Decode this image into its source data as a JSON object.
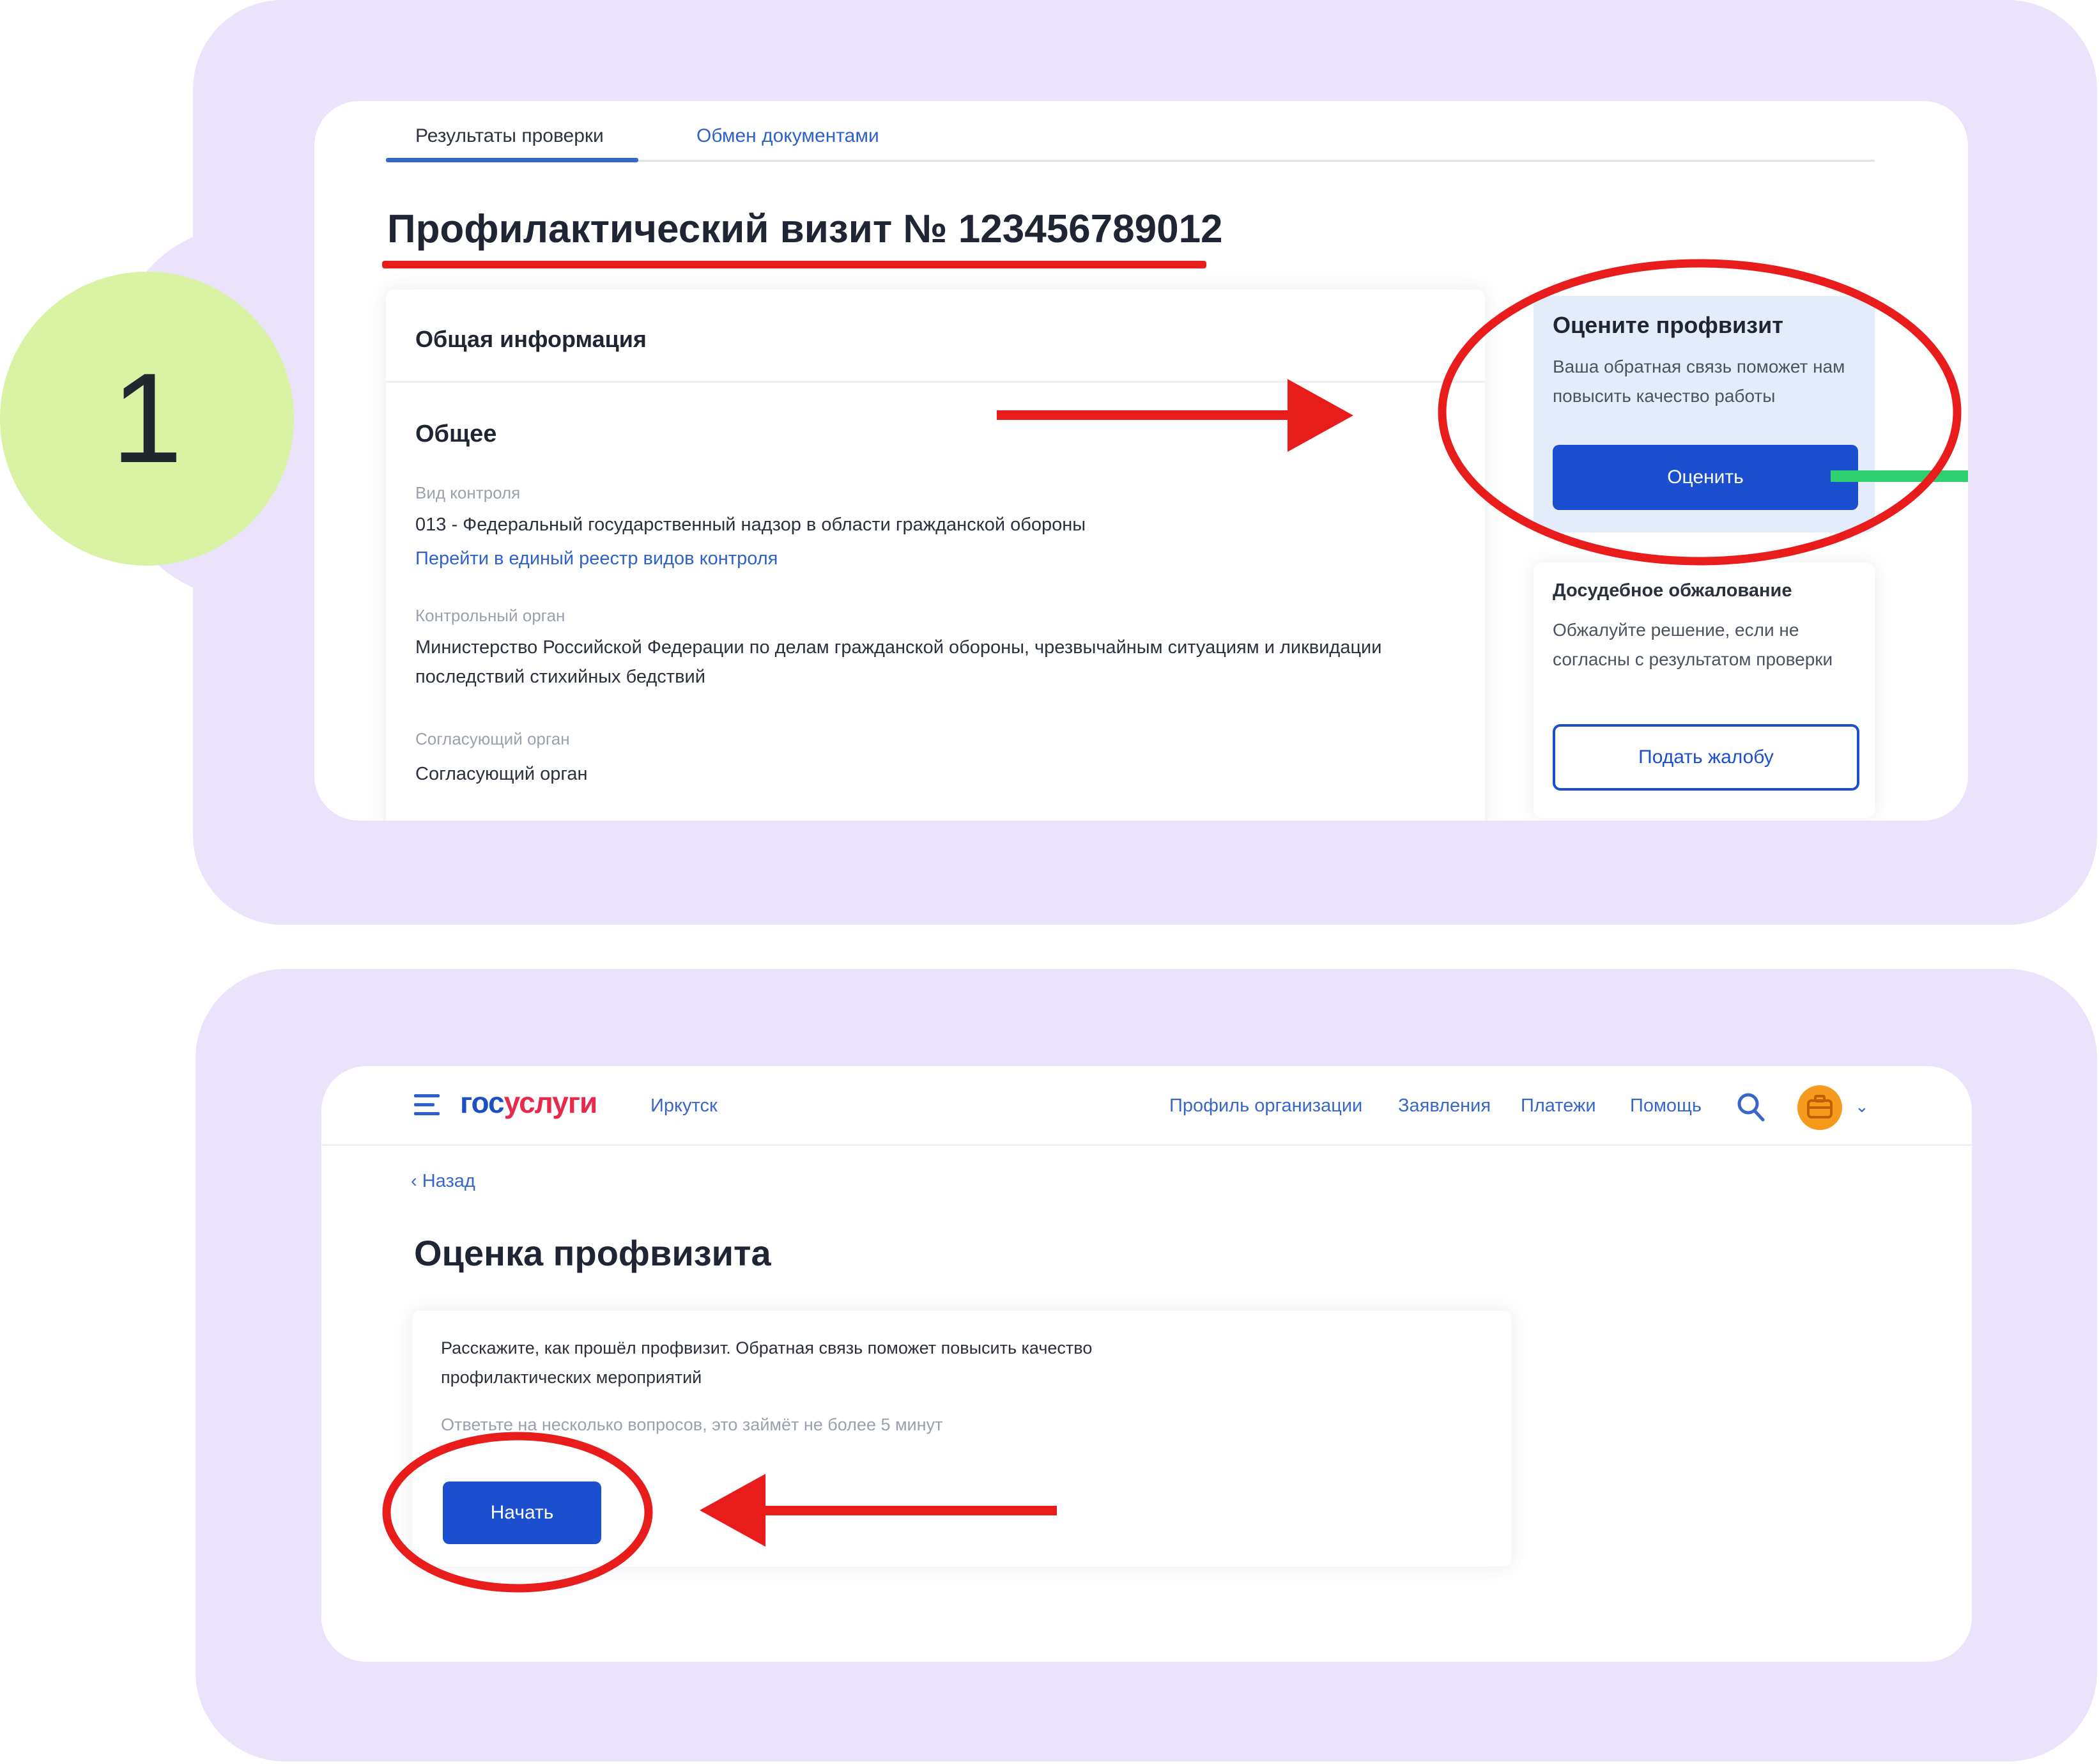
{
  "step_number": "1",
  "card1": {
    "tabs": [
      "Результаты проверки",
      "Обмен документами"
    ],
    "title": "Профилактический визит № 123456789012",
    "info_header": "Общая информация",
    "section_title": "Общее",
    "fields": [
      {
        "label": "Вид контроля",
        "value": "013 - Федеральный государственный надзор в области гражданской обороны"
      },
      {
        "link": "Перейти в единый реестр видов контроля"
      },
      {
        "label": "Контрольный орган",
        "value": "Министерство Российской Федерации по делам гражданской обороны, чрезвычайным ситуациям и ликвидации последствий стихийных бедствий"
      },
      {
        "label": "Согласующий орган",
        "value": "Согласующий орган"
      }
    ],
    "rate": {
      "title": "Оцените профвизит",
      "text": "Ваша обратная связь поможет нам повысить качество работы",
      "button": "Оценить"
    },
    "appeal": {
      "title": "Досудебное обжалование",
      "text": "Обжалуйте решение, если не согласны с результатом проверки",
      "button": "Подать жалобу"
    }
  },
  "card2": {
    "logo_part1": "гос",
    "logo_part2": "услуги",
    "city": "Иркутск",
    "nav": [
      "Профиль организации",
      "Заявления",
      "Платежи",
      "Помощь"
    ],
    "back": "Назад",
    "page_title": "Оценка профвизита",
    "description": "Расскажите, как прошёл профвизит. Обратная связь поможет повысить качество профилактических мероприятий",
    "hint": "Ответьте на несколько вопросов, это займёт не более 5 минут",
    "start_button": "Начать"
  },
  "colors": {
    "slab": "#ebe3fb",
    "step_circle": "#d9f2a3",
    "primary_blue": "#1b4fd0",
    "annotation_red": "#e91c1c",
    "logo_red": "#e8294b"
  },
  "icons": [
    "hamburger-icon",
    "search-icon",
    "avatar-icon",
    "chevron-down-icon",
    "back-chevron-icon",
    "arrow-right-annotation",
    "arrow-left-annotation"
  ]
}
